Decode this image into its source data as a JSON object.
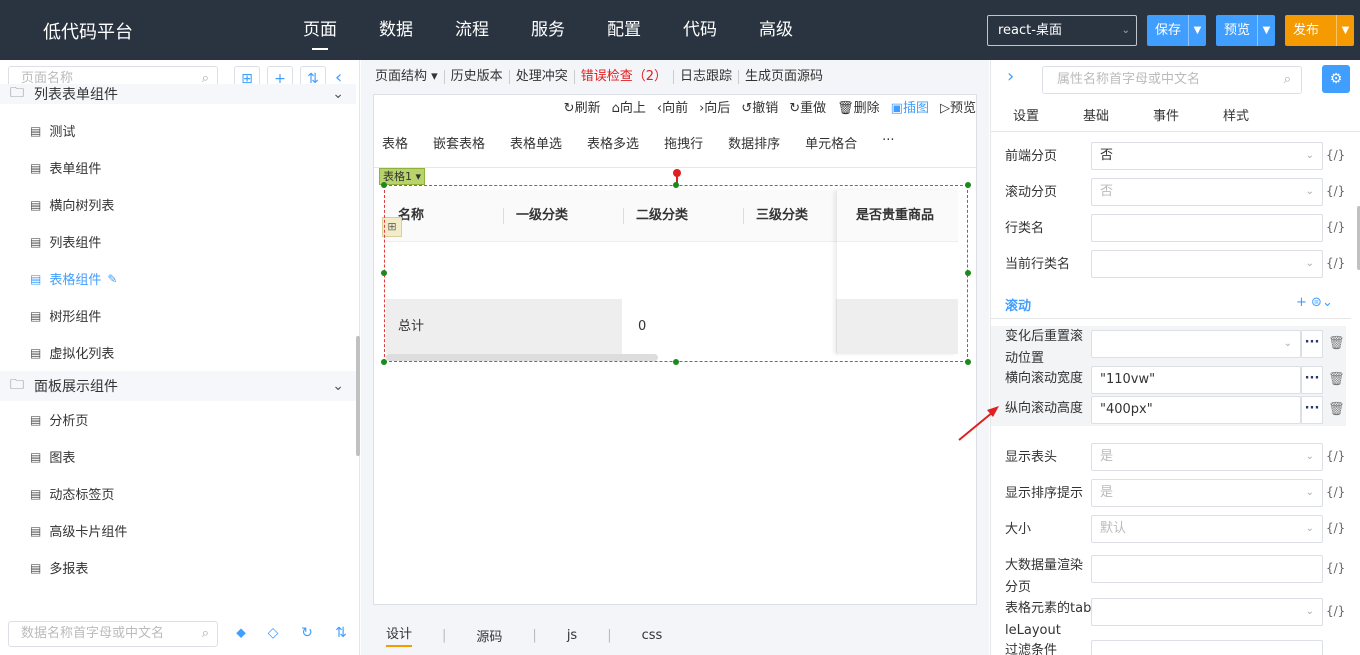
{
  "header": {
    "logo": "低代码平台",
    "nav": [
      "页面",
      "数据",
      "流程",
      "服务",
      "配置",
      "代码",
      "高级"
    ],
    "active_nav": 0,
    "env_select": "react-桌面",
    "save": "保存",
    "preview": "预览",
    "publish": "发布"
  },
  "left": {
    "search_placeholder": "页面名称",
    "groups": [
      {
        "label": "列表表单组件",
        "items": [
          "测试",
          "表单组件",
          "横向树列表",
          "列表组件",
          "表格组件",
          "树形组件",
          "虚拟化列表"
        ],
        "active_item": 4
      },
      {
        "label": "面板展示组件",
        "items": [
          "分析页",
          "图表",
          "动态标签页",
          "高级卡片组件",
          "多报表"
        ]
      }
    ],
    "bottom_search_placeholder": "数据名称首字母或中文名"
  },
  "center": {
    "toolbar": [
      "页面结构 ▾",
      "历史版本",
      "处理冲突",
      "错误检查（2）",
      "日志跟踪",
      "生成页面源码"
    ],
    "canvas_actions": [
      "刷新",
      "向上",
      "向前",
      "向后",
      "撤销",
      "重做",
      "删除",
      "插图",
      "预览"
    ],
    "tabs": [
      "表格",
      "嵌套表格",
      "表格单选",
      "表格多选",
      "拖拽行",
      "数据排序",
      "单元格合",
      "···"
    ],
    "table_tag": "表格1",
    "columns": [
      "名称",
      "一级分类",
      "二级分类",
      "三级分类",
      "是否贵重商品"
    ],
    "total_label": "总计",
    "total_value": "0",
    "bottom_tabs": [
      "设计",
      "源码",
      "js",
      "css"
    ]
  },
  "right": {
    "search_placeholder": "属性名称首字母或中文名",
    "tabs": [
      "设置",
      "基础",
      "事件",
      "样式"
    ],
    "props": [
      {
        "label": "前端分页",
        "value": "否",
        "disabled": false
      },
      {
        "label": "滚动分页",
        "value": "否",
        "disabled": true
      },
      {
        "label": "行类名",
        "value": "",
        "disabled": false
      },
      {
        "label": "当前行类名",
        "value": "",
        "disabled": false
      }
    ],
    "section": "滚动",
    "scroll_rows": [
      {
        "label": "变化后重置滚动位置",
        "value": ""
      },
      {
        "label": "横向滚动宽度",
        "value": "\"110vw\""
      },
      {
        "label": "纵向滚动高度",
        "value": "\"400px\""
      }
    ],
    "props2": [
      {
        "label": "显示表头",
        "value": "是",
        "disabled": true
      },
      {
        "label": "显示排序提示",
        "value": "是",
        "disabled": true
      },
      {
        "label": "大小",
        "value": "默认",
        "disabled": true
      },
      {
        "label": "大数据量渲染分页",
        "value": "",
        "disabled": false
      },
      {
        "label": "表格元素的tableLayout",
        "value": "",
        "disabled": false
      },
      {
        "label": "过滤条件",
        "value": "",
        "disabled": false
      }
    ],
    "fx": "{/}"
  },
  "colors": {
    "topbar": "#2a3340",
    "primary": "#409eff",
    "publish": "#f59a00",
    "error": "#e02020"
  }
}
